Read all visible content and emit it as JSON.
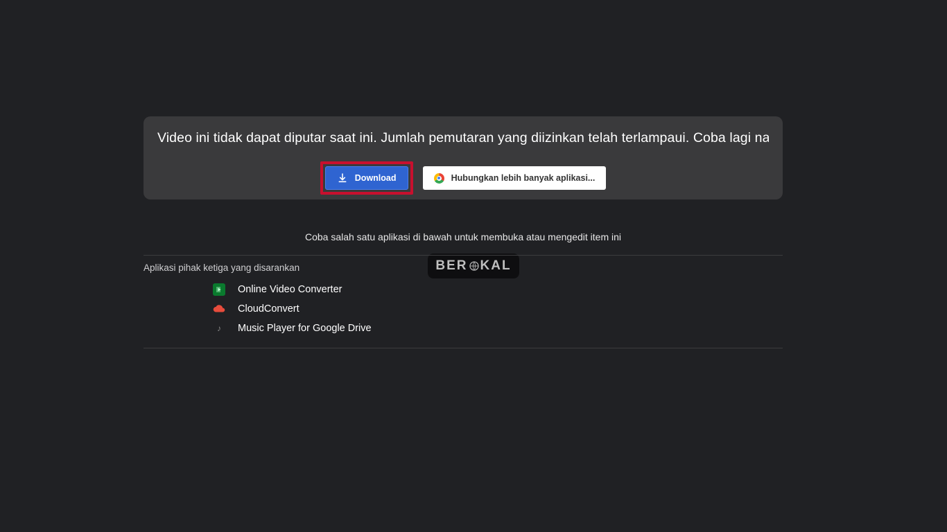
{
  "card": {
    "message": "Video ini tidak dapat diputar saat ini. Jumlah pemutaran yang diizinkan telah terlampaui. Coba lagi nanti.",
    "download_label": "Download",
    "connect_label": "Hubungkan lebih banyak aplikasi..."
  },
  "hint": "Coba salah satu aplikasi di bawah untuk membuka atau mengedit item ini",
  "section_title": "Aplikasi pihak ketiga yang disarankan",
  "apps": {
    "0": {
      "label": "Online Video Converter"
    },
    "1": {
      "label": "CloudConvert"
    },
    "2": {
      "label": "Music Player for Google Drive"
    }
  },
  "watermark": "BERAKAL"
}
